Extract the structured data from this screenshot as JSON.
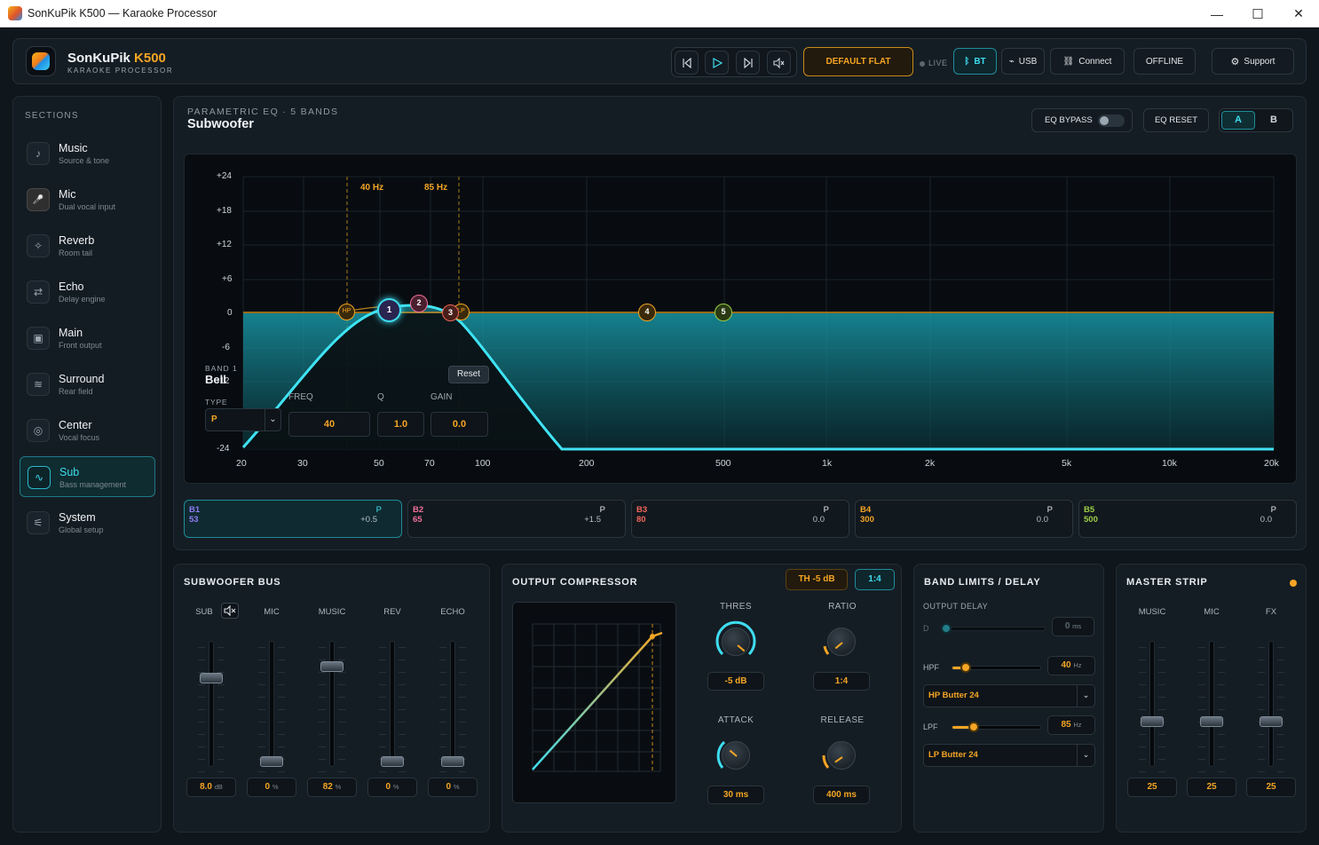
{
  "window": {
    "title": "SonKuPik K500 — Karaoke Processor",
    "minimize": "—",
    "maximize": "☐",
    "close": "✕"
  },
  "header": {
    "brand": "SonKuPik",
    "brand_model": "K500",
    "brand_sub": "KARAOKE PROCESSOR",
    "preset": "DEFAULT FLAT",
    "live": "LIVE",
    "bt": "BT",
    "usb": "USB",
    "connect": "Connect",
    "offline": "OFFLINE",
    "support": "Support"
  },
  "sidebar": {
    "heading": "SECTIONS",
    "items": [
      {
        "label": "Music",
        "sub": "Source & tone",
        "icon": "♪"
      },
      {
        "label": "Mic",
        "sub": "Dual vocal input",
        "icon": "🎤"
      },
      {
        "label": "Reverb",
        "sub": "Room tail",
        "icon": "✧"
      },
      {
        "label": "Echo",
        "sub": "Delay engine",
        "icon": "⇄"
      },
      {
        "label": "Main",
        "sub": "Front output",
        "icon": "▣"
      },
      {
        "label": "Surround",
        "sub": "Rear field",
        "icon": "≋"
      },
      {
        "label": "Center",
        "sub": "Vocal focus",
        "icon": "◎"
      },
      {
        "label": "Sub",
        "sub": "Bass management",
        "icon": "∿"
      },
      {
        "label": "System",
        "sub": "Global setup",
        "icon": "⚟"
      }
    ]
  },
  "eq": {
    "heading": "PARAMETRIC EQ · 5 BANDS",
    "title": "Subwoofer",
    "bypass": "EQ BYPASS",
    "reset": "EQ RESET",
    "ab_a": "A",
    "ab_b": "B",
    "y_ticks": [
      "+24",
      "+18",
      "+12",
      "+6",
      "0",
      "-6",
      "-12",
      "-24"
    ],
    "x_ticks": [
      "20",
      "30",
      "50",
      "70",
      "100",
      "200",
      "500",
      "1k",
      "2k",
      "5k",
      "10k",
      "20k"
    ],
    "hp_freq_label": "40 Hz",
    "lp_freq_label": "85 Hz",
    "band_panel": {
      "band_label": "BAND 1",
      "shape": "Bell",
      "type_label": "TYPE",
      "type_value": "P",
      "freq_label": "FREQ",
      "freq_value": "40",
      "q_label": "Q",
      "q_value": "1.0",
      "gain_label": "GAIN",
      "gain_value": "0.0"
    },
    "reset_tooltip": "Reset",
    "node_labels": {
      "hp": "HP",
      "lp": "LP",
      "b1": "1",
      "b2": "2",
      "b3": "3",
      "b4": "4",
      "b5": "5"
    },
    "bands": [
      {
        "name": "B1",
        "freq": "53",
        "type": "P",
        "gain": "+0.5",
        "color": "#8f7cf5"
      },
      {
        "name": "B2",
        "freq": "65",
        "type": "P",
        "gain": "+1.5",
        "color": "#f0709a"
      },
      {
        "name": "B3",
        "freq": "80",
        "type": "P",
        "gain": "0.0",
        "color": "#f0675a"
      },
      {
        "name": "B4",
        "freq": "300",
        "type": "P",
        "gain": "0.0",
        "color": "#f5a524"
      },
      {
        "name": "B5",
        "freq": "500",
        "type": "P",
        "gain": "0.0",
        "color": "#9ccc45"
      }
    ]
  },
  "sub_bus": {
    "title": "SUBWOOFER BUS",
    "faders": [
      {
        "label": "SUB",
        "value": "8.0",
        "unit": "dB",
        "level": 0.72
      },
      {
        "label": "MIC",
        "value": "0",
        "unit": "%",
        "level": 0.0
      },
      {
        "label": "MUSIC",
        "value": "82",
        "unit": "%",
        "level": 0.82
      },
      {
        "label": "REV",
        "value": "0",
        "unit": "%",
        "level": 0.0
      },
      {
        "label": "ECHO",
        "value": "0",
        "unit": "%",
        "level": 0.0
      }
    ]
  },
  "compressor": {
    "title": "OUTPUT COMPRESSOR",
    "th_badge": "TH -5 dB",
    "ratio_badge": "1:4",
    "thres_label": "THRES",
    "thres_value": "-5 dB",
    "ratio_label": "RATIO",
    "ratio_value": "1:4",
    "attack_label": "ATTACK",
    "attack_value": "30 ms",
    "release_label": "RELEASE",
    "release_value": "400 ms"
  },
  "limits": {
    "title": "BAND LIMITS / DELAY",
    "delay_label": "OUTPUT DELAY",
    "delay_d": "D",
    "delay_value": "0",
    "delay_unit": "ms",
    "hpf_label": "HPF",
    "hpf_value": "40",
    "hpf_unit": "Hz",
    "hpf_type": "HP Butter 24",
    "lpf_label": "LPF",
    "lpf_value": "85",
    "lpf_unit": "Hz",
    "lpf_type": "LP Butter 24",
    "caret": "⌄"
  },
  "master": {
    "title": "MASTER STRIP",
    "faders": [
      {
        "label": "MUSIC",
        "value": "25",
        "level": 0.35
      },
      {
        "label": "MIC",
        "value": "25",
        "level": 0.35
      },
      {
        "label": "FX",
        "value": "25",
        "level": 0.35
      }
    ]
  },
  "colors": {
    "accent": "#3fdcef",
    "amber": "#f5a524"
  }
}
